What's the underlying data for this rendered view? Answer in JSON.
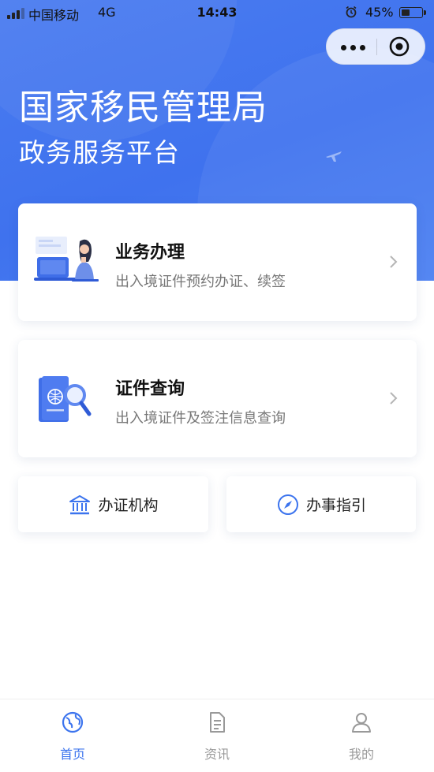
{
  "status_bar": {
    "carrier": "中国移动",
    "network": "4G",
    "time": "14:43",
    "battery_percent": "45%",
    "battery_level": 0.45
  },
  "colors": {
    "primary": "#3c74ee",
    "hero_bg": "#4a7cf0",
    "muted": "#999999"
  },
  "header": {
    "title": "国家移民管理局",
    "subtitle": "政务服务平台"
  },
  "cards": [
    {
      "title": "业务办理",
      "subtitle": "出入境证件预约办证、续签",
      "icon": "business-person-illustration"
    },
    {
      "title": "证件查询",
      "subtitle": "出入境证件及签注信息查询",
      "icon": "passport-search-illustration"
    }
  ],
  "quick_links": [
    {
      "label": "办证机构",
      "icon": "bank-icon"
    },
    {
      "label": "办事指引",
      "icon": "compass-icon"
    }
  ],
  "tabbar": [
    {
      "label": "首页",
      "icon": "globe-icon",
      "active": true
    },
    {
      "label": "资讯",
      "icon": "document-icon",
      "active": false
    },
    {
      "label": "我的",
      "icon": "user-icon",
      "active": false
    }
  ]
}
